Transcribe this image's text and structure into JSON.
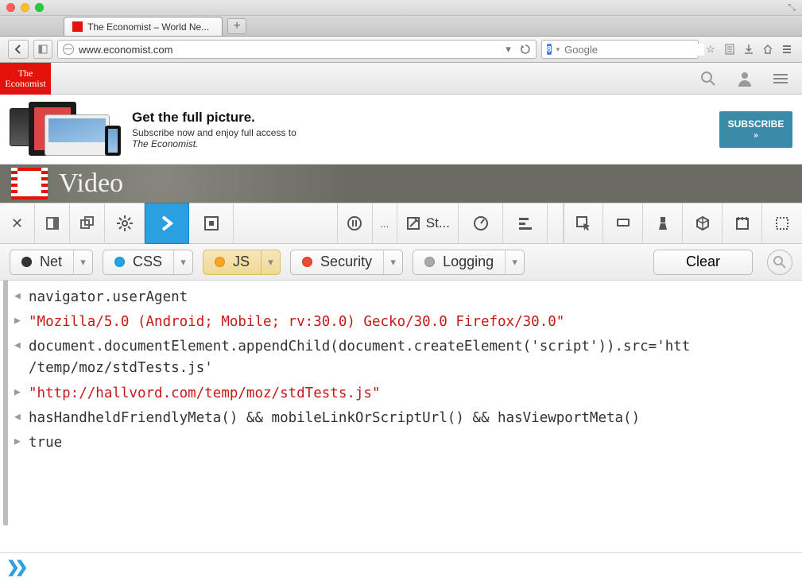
{
  "window": {
    "tab_title": "The Economist – World Ne...",
    "expand_hint": "⤢"
  },
  "nav": {
    "url": "www.economist.com",
    "search_engine": "8",
    "search_placeholder": "Google",
    "reload_label": "C"
  },
  "site": {
    "logo_line1": "The",
    "logo_line2": "Economist",
    "promo_title": "Get the full picture.",
    "promo_sub1": "Subscribe now and enjoy full access to",
    "promo_sub2": "The Economist.",
    "subscribe": "SUBSCRIBE",
    "subscribe_chev": "»",
    "video_label": "Video"
  },
  "devtools": {
    "style_label": "St...",
    "ellipsis": "...",
    "filters": {
      "net": "Net",
      "css": "CSS",
      "js": "JS",
      "security": "Security",
      "logging": "Logging"
    },
    "clear": "Clear"
  },
  "console": {
    "l1": "navigator.userAgent",
    "l2": "\"Mozilla/5.0 (Android; Mobile; rv:30.0) Gecko/30.0 Firefox/30.0\"",
    "l3": "document.documentElement.appendChild(document.createElement('script')).src='htt/temp/moz/stdTests.js'",
    "l3a": "document.documentElement.appendChild(document.createElement('script')).src='htt",
    "l3b": "/temp/moz/stdTests.js'",
    "l4": "\"http://hallvord.com/temp/moz/stdTests.js\"",
    "l5": "hasHandheldFriendlyMeta() && mobileLinkOrScriptUrl() && hasViewportMeta()",
    "l6": "true"
  },
  "prompt": {
    "chev": "≫"
  }
}
